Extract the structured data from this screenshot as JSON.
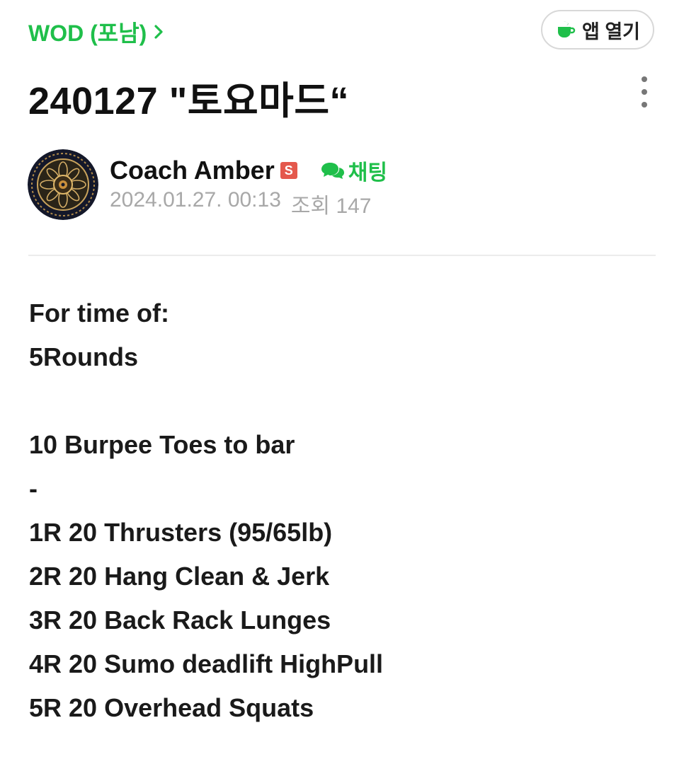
{
  "header": {
    "cafe_board_label": "WOD (포남)",
    "open_app_label": "앱 열기"
  },
  "post": {
    "title": "240127 \"토요마드“",
    "author": {
      "name": "Coach Amber",
      "badge": "S",
      "chat_label": "채팅"
    },
    "date": "2024.01.27. 00:13",
    "views_label": "조회",
    "views": "147",
    "body_lines": [
      "For time of:",
      "5Rounds",
      "",
      "10 Burpee Toes to bar",
      "-",
      "1R 20 Thrusters (95/65lb)",
      "2R 20 Hang Clean & Jerk",
      "3R 20 Back Rack Lunges",
      "4R 20 Sumo deadlift HighPull",
      "5R 20 Overhead Squats"
    ]
  },
  "colors": {
    "brand_green": "#1fbf4a",
    "badge_red": "#e4584c",
    "meta_gray": "#a8a8a8"
  },
  "icons": [
    "chevron-right-icon",
    "coffee-cup-icon",
    "more-vertical-icon",
    "chat-bubble-icon",
    "mandala-avatar"
  ]
}
